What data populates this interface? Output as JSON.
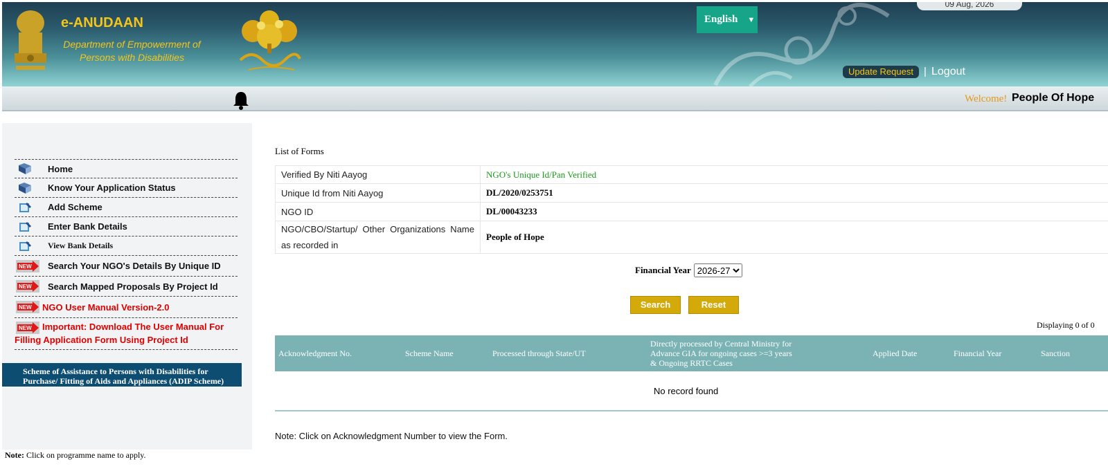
{
  "header": {
    "brand_title": "e-ANUDAAN",
    "brand_subtitle": "Department of Empowerment of Persons with Disabilities",
    "language": "English",
    "date": "09 Aug, 2026",
    "update_request_label": "Update Request",
    "logout_label": "Logout"
  },
  "welcome": {
    "label": "Welcome!",
    "name": "People Of Hope"
  },
  "sidebar": {
    "items": [
      {
        "label": "Home",
        "icon": "book-icon"
      },
      {
        "label": "Know Your Application Status",
        "icon": "book-icon"
      },
      {
        "label": "Add Scheme",
        "icon": "pen-book-icon"
      },
      {
        "label": "Enter Bank Details",
        "icon": "pen-book-icon"
      },
      {
        "label": "View Bank Details",
        "icon": "pen-book-icon"
      },
      {
        "label": "Search Your NGO's Details By Unique ID",
        "icon": "new-badge-icon"
      },
      {
        "label": "Search Mapped Proposals By Project Id",
        "icon": "new-badge-icon"
      },
      {
        "label": "NGO User Manual Version-2.0",
        "icon": "new-badge-icon"
      },
      {
        "label": "Important: Download The User Manual For Filling Application Form Using Project Id",
        "icon": "new-badge-icon"
      }
    ],
    "scheme_label": "Scheme of Assistance to Persons with Disabilities for Purchase/ Fitting of Aids and Appliances (ADIP Scheme)",
    "note_prefix": "Note:",
    "note_text": "Click on programme name to apply."
  },
  "main": {
    "title": "List of Forms",
    "info_rows": [
      {
        "label": "Verified By Niti Aayog",
        "value": "NGO's Unique Id/Pan Verified"
      },
      {
        "label": "Unique Id from Niti Aayog",
        "value": "DL/2020/0253751"
      },
      {
        "label": "NGO ID",
        "value": "DL/00043233"
      },
      {
        "label": "NGO/CBO/Startup/ Other Organizations Name as recorded in",
        "value": "People of Hope"
      }
    ],
    "financial_year_label": "Financial Year",
    "financial_year_value": "2026-27",
    "search_label": "Search",
    "reset_label": "Reset",
    "displaying": "Displaying 0 of 0",
    "columns": [
      "Acknowledgment No.",
      "Scheme Name",
      "Processed through State/UT",
      "Directly processed by Central Ministry for Advance GIA for ongoing cases >=3 years & Ongoing RRTC Cases",
      "Applied Date",
      "Financial Year",
      "Sanction"
    ],
    "no_record": "No record found",
    "note": "Note: Click on Acknowledgment Number to view the Form."
  },
  "colors": {
    "header_dark": "#1f3f52",
    "accent_teal": "#17a589",
    "brand_yellow": "#f5c518",
    "button_gold": "#d4a90a",
    "grid_header": "#7bb3b4",
    "scheme_blue": "#0e4d72",
    "verified_green": "#1a9b1a",
    "important_red": "#e00000"
  }
}
